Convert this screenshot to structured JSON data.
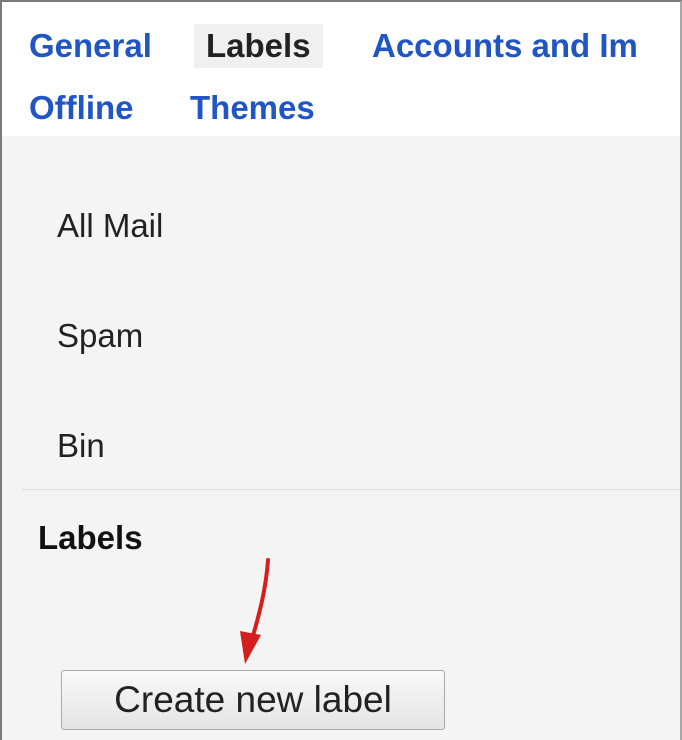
{
  "tabs": [
    {
      "label": "General",
      "active": false
    },
    {
      "label": "Labels",
      "active": true
    },
    {
      "label": "Accounts and Im",
      "active": false
    },
    {
      "label": "Offline",
      "active": false
    },
    {
      "label": "Themes",
      "active": false
    }
  ],
  "system_labels": [
    "All Mail",
    "Spam",
    "Bin"
  ],
  "labels_section": {
    "heading": "Labels",
    "create_button_label": "Create new label"
  },
  "colors": {
    "tab_link": "#1f55c4",
    "tab_active_text": "#222222",
    "tab_active_bg": "#f0f0f0",
    "panel_bg": "#f4f4f4",
    "annotation_arrow": "#d41f1f"
  },
  "annotation": {
    "icon": "red-arrow-icon",
    "points_to": "create-new-label-button"
  }
}
